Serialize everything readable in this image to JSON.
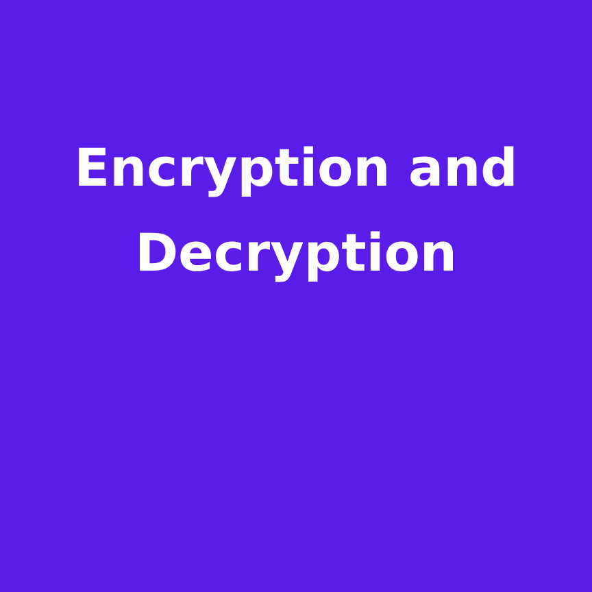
{
  "background_color": "#5a1ce8",
  "text_color": "#ffffff",
  "title": {
    "line1": "Encryption and",
    "line2": "Decryption"
  }
}
